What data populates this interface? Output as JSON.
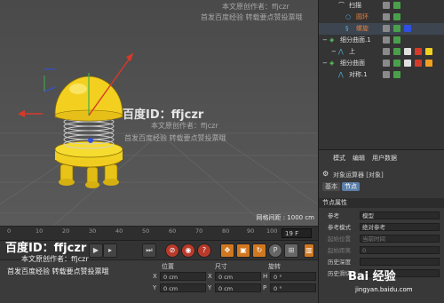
{
  "viewport": {
    "info_label": "网格间距 : 1000 cm"
  },
  "timeline": {
    "ticks": [
      "0",
      "10",
      "20",
      "30",
      "40",
      "50",
      "60",
      "70",
      "80",
      "90",
      "100"
    ],
    "current_frame": "19 F"
  },
  "coords": {
    "col_position": "位置",
    "col_size": "尺寸",
    "col_rotation": "旋转",
    "rows": [
      {
        "axis": "X",
        "position": "0 cm",
        "size_axis": "X",
        "size": "0 cm",
        "rot_axis": "H",
        "rotation": "0 °"
      },
      {
        "axis": "Y",
        "position": "0 cm",
        "size_axis": "Y",
        "size": "0 cm",
        "rot_axis": "P",
        "rotation": "0 °"
      }
    ]
  },
  "objects": {
    "rows": [
      {
        "label": "扫描"
      },
      {
        "label": "圆环"
      },
      {
        "label": "螺旋"
      },
      {
        "label": "细分曲面.1"
      },
      {
        "label": "上"
      },
      {
        "label": "细分曲面"
      },
      {
        "label": "对称.1"
      }
    ]
  },
  "attributes": {
    "menu": [
      "模式",
      "编辑",
      "用户数据"
    ],
    "title": "对象运算器 [对象]",
    "tabs": [
      "基本",
      "节点"
    ],
    "section": "节点属性",
    "params": [
      {
        "label": "参考",
        "value": "模型",
        "dim": false
      },
      {
        "label": "参考模式",
        "value": "绝对参考",
        "dim": false
      },
      {
        "label": "起始位置",
        "value": "当前时间",
        "dim": true
      },
      {
        "label": "起始距离",
        "value": "0",
        "dim": true
      },
      {
        "label": "历史深度",
        "value": "",
        "dim": false
      },
      {
        "label": "历史滑块",
        "value": "",
        "dim": false
      }
    ]
  },
  "watermark": {
    "brand_line": "百度ID：ffjczr",
    "author_line": "本文原创作者：ffjczr",
    "notice_line": "首发百度经验  转载要点赞投票哦",
    "site_logo": "Bai 经验",
    "site_url": "jingyan.baidu.com"
  },
  "colors": {
    "object_yellow": "#f0d020",
    "axis_red": "#d63a2a",
    "axis_green": "#3ab04a",
    "axis_blue": "#3050e0",
    "selection": "#3d4650"
  }
}
